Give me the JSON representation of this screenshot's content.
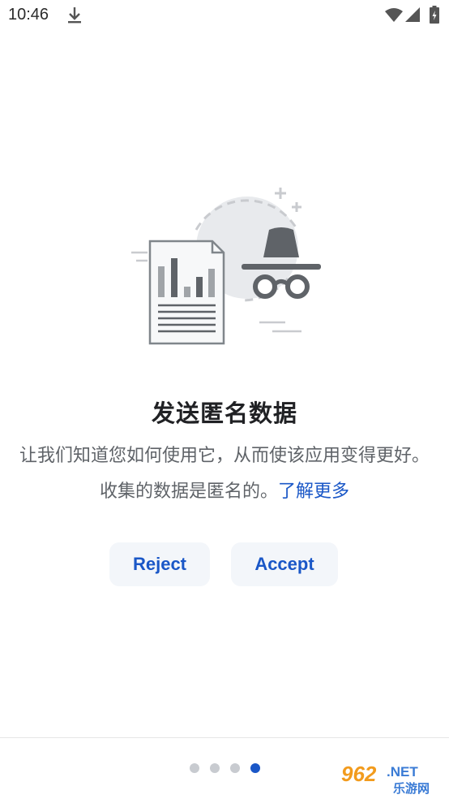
{
  "status_bar": {
    "time": "10:46",
    "icons": [
      "download-icon",
      "wifi-icon",
      "signal-icon",
      "battery-icon"
    ]
  },
  "onboarding": {
    "title": "发送匿名数据",
    "description": "让我们知道您如何使用它，从而使该应用变得更好。收集的数据是匿名的。",
    "learn_more": "了解更多",
    "illustration": "document-chart-and-incognito-icon"
  },
  "buttons": {
    "reject_label": "Reject",
    "accept_label": "Accept"
  },
  "pager": {
    "total": 4,
    "active_index": 3
  },
  "watermark": {
    "number": "962",
    "suffix": ".NET",
    "caption": "乐游网"
  },
  "colors": {
    "accent": "#1a57c7",
    "button_bg": "#f3f6fa",
    "text_secondary": "#5f6368",
    "dot_inactive": "#c8cbd0"
  }
}
